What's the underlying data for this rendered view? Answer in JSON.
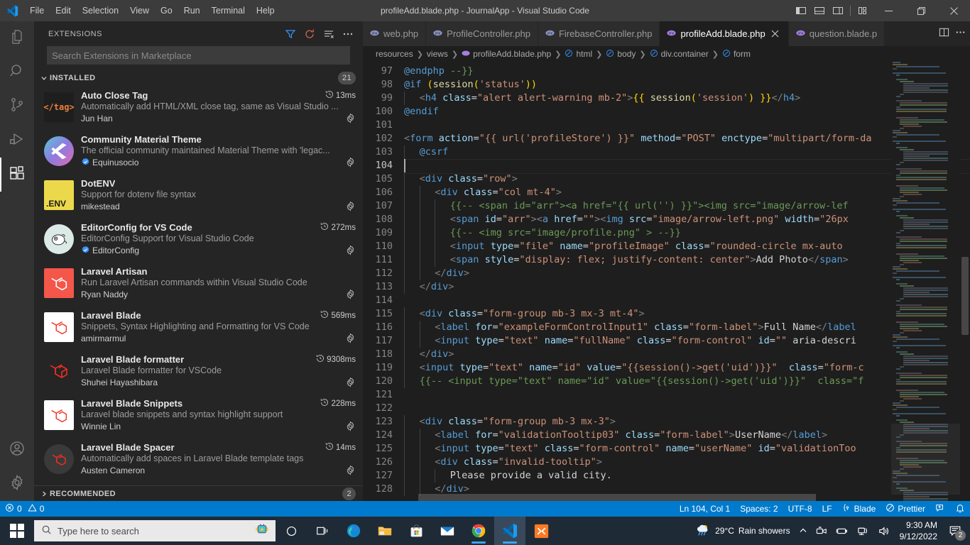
{
  "titlebar": {
    "menus": [
      "File",
      "Edit",
      "Selection",
      "View",
      "Go",
      "Run",
      "Terminal",
      "Help"
    ],
    "window_title": "profileAdd.blade.php - JournalApp - Visual Studio Code",
    "layout_buttons": [
      "toggle-primary-sidebar",
      "toggle-panel",
      "toggle-secondary-sidebar",
      "customize-layout"
    ],
    "window_controls": [
      "minimize",
      "restore",
      "close"
    ]
  },
  "activitybar": {
    "items": [
      {
        "name": "explorer",
        "icon": "files-icon",
        "active": false
      },
      {
        "name": "search",
        "icon": "search-icon",
        "active": false
      },
      {
        "name": "source-control",
        "icon": "source-control-icon",
        "active": false
      },
      {
        "name": "run-and-debug",
        "icon": "run-debug-icon",
        "active": false
      },
      {
        "name": "extensions",
        "icon": "extensions-icon",
        "active": true
      }
    ],
    "bottom": [
      {
        "name": "accounts",
        "icon": "account-icon"
      },
      {
        "name": "manage",
        "icon": "gear-icon"
      }
    ]
  },
  "sidebar": {
    "title": "EXTENSIONS",
    "actions": [
      "filter-icon",
      "refresh-icon",
      "clear-search-results-icon",
      "more-actions-icon"
    ],
    "search": {
      "value": "",
      "placeholder": "Search Extensions in Marketplace"
    },
    "installed": {
      "label": "INSTALLED",
      "count": "21",
      "expanded": true
    },
    "recommended": {
      "label": "RECOMMENDED",
      "count": "2",
      "expanded": false
    },
    "extensions": [
      {
        "name": "Auto Close Tag",
        "description": "Automatically add HTML/XML close tag, same as Visual Studio ...",
        "publisher": "Jun Han",
        "verified": false,
        "activation_time": "13ms",
        "icon_kind": "tag-text",
        "icon_text": "</tag>",
        "icon_bg": "#1e1e1e",
        "icon_fg": "#e8803a"
      },
      {
        "name": "Community Material Theme",
        "description": "The official community maintained Material Theme with 'legac...",
        "publisher": "Equinusocio",
        "verified": true,
        "activation_time": "",
        "icon_kind": "gradient-circle",
        "icon_text": "",
        "icon_bg": "#5bc8d6",
        "icon_fg": "#ffffff"
      },
      {
        "name": "DotENV",
        "description": "Support for dotenv file syntax",
        "publisher": "mikestead",
        "verified": false,
        "activation_time": "",
        "icon_kind": "env-square",
        "icon_text": ".ENV",
        "icon_bg": "#ecd94b",
        "icon_fg": "#1a1a1a"
      },
      {
        "name": "EditorConfig for VS Code",
        "description": "EditorConfig Support for Visual Studio Code",
        "publisher": "EditorConfig",
        "verified": true,
        "activation_time": "272ms",
        "icon_kind": "mouse-circle",
        "icon_text": "",
        "icon_bg": "#dbeae6",
        "icon_fg": "#2b2b2b"
      },
      {
        "name": "Laravel Artisan",
        "description": "Run Laravel Artisan commands within Visual Studio Code",
        "publisher": "Ryan Naddy",
        "verified": false,
        "activation_time": "",
        "icon_kind": "laravel-orange",
        "icon_text": "",
        "icon_bg": "#f4564a",
        "icon_fg": "#ffffff"
      },
      {
        "name": "Laravel Blade",
        "description": "Snippets, Syntax Highlighting and Formatting for VS Code",
        "publisher": "amirmarmul",
        "verified": false,
        "activation_time": "569ms",
        "icon_kind": "laravel-white",
        "icon_text": "",
        "icon_bg": "#ffffff",
        "icon_fg": "#ef3b2d"
      },
      {
        "name": "Laravel Blade formatter",
        "description": "Laravel Blade formatter for VSCode",
        "publisher": "Shuhei Hayashibara",
        "verified": false,
        "activation_time": "9308ms",
        "icon_kind": "laravel-outline",
        "icon_text": "",
        "icon_bg": "#252526",
        "icon_fg": "#ff2d20"
      },
      {
        "name": "Laravel Blade Snippets",
        "description": "Laravel blade snippets and syntax highlight support",
        "publisher": "Winnie Lin",
        "verified": false,
        "activation_time": "228ms",
        "icon_kind": "laravel-white",
        "icon_text": "",
        "icon_bg": "#ffffff",
        "icon_fg": "#ef3b2d"
      },
      {
        "name": "Laravel Blade Spacer",
        "description": "Automatically add spaces in Laravel Blade template tags",
        "publisher": "Austen Cameron",
        "verified": false,
        "activation_time": "14ms",
        "icon_kind": "laravel-dark-circle",
        "icon_text": "",
        "icon_bg": "#3a3a3a",
        "icon_fg": "#ff2d20"
      }
    ]
  },
  "editor": {
    "tabs": [
      {
        "label": "web.php",
        "active": false,
        "icon": "php-icon"
      },
      {
        "label": "ProfileController.php",
        "active": false,
        "icon": "php-icon"
      },
      {
        "label": "FirebaseController.php",
        "active": false,
        "icon": "php-icon"
      },
      {
        "label": "profileAdd.blade.php",
        "active": true,
        "icon": "php-icon"
      },
      {
        "label": "question.blade.p",
        "active": false,
        "icon": "php-icon"
      }
    ],
    "tab_actions": [
      "split-editor-icon",
      "more-actions-icon"
    ],
    "breadcrumbs": [
      {
        "label": "resources",
        "icon": ""
      },
      {
        "label": "views",
        "icon": ""
      },
      {
        "label": "profileAdd.blade.php",
        "icon": "php-icon"
      },
      {
        "label": "html",
        "icon": "symbol-field-icon"
      },
      {
        "label": "body",
        "icon": "symbol-field-icon"
      },
      {
        "label": "div.container",
        "icon": "symbol-field-icon"
      },
      {
        "label": "form",
        "icon": "symbol-field-icon"
      }
    ],
    "first_line_number": 97,
    "current_line": 104,
    "lines": [
      {
        "n": 97,
        "indent": 0,
        "text": "@endphp --}}"
      },
      {
        "n": 98,
        "indent": 0,
        "text": "@if (session('status'))"
      },
      {
        "n": 99,
        "indent": 1,
        "text": "<h4 class=\"alert alert-warning mb-2\">{{ session('session') }}</h4>"
      },
      {
        "n": 100,
        "indent": 0,
        "text": "@endif"
      },
      {
        "n": 101,
        "indent": 0,
        "text": ""
      },
      {
        "n": 102,
        "indent": 0,
        "text": "<form action=\"{{ url('profileStore') }}\" method=\"POST\" enctype=\"multipart/form-da"
      },
      {
        "n": 103,
        "indent": 1,
        "text": "@csrf"
      },
      {
        "n": 104,
        "indent": 0,
        "text": ""
      },
      {
        "n": 105,
        "indent": 1,
        "text": "<div class=\"row\">"
      },
      {
        "n": 106,
        "indent": 2,
        "text": "<div class=\"col mt-4\">"
      },
      {
        "n": 107,
        "indent": 3,
        "text": "{{-- <span id=\"arr\"><a href=\"{{ url('') }}\"><img src=\"image/arrow-lef"
      },
      {
        "n": 108,
        "indent": 3,
        "text": "<span id=\"arr\"><a href=\"\"><img src=\"image/arrow-left.png\" width=\"26px"
      },
      {
        "n": 109,
        "indent": 3,
        "text": "{{-- <img src=\"image/profile.png\" > --}}"
      },
      {
        "n": 110,
        "indent": 3,
        "text": "<input type=\"file\" name=\"profileImage\" class=\"rounded-circle mx-auto"
      },
      {
        "n": 111,
        "indent": 3,
        "text": "<span style=\"display: flex; justify-content: center\">Add Photo</span>"
      },
      {
        "n": 112,
        "indent": 2,
        "text": "</div>"
      },
      {
        "n": 113,
        "indent": 1,
        "text": "</div>"
      },
      {
        "n": 114,
        "indent": 0,
        "text": ""
      },
      {
        "n": 115,
        "indent": 1,
        "text": "<div class=\"form-group mb-3 mx-3 mt-4\">"
      },
      {
        "n": 116,
        "indent": 2,
        "text": "<label for=\"exampleFormControlInput1\" class=\"form-label\">Full Name</label"
      },
      {
        "n": 117,
        "indent": 2,
        "text": "<input type=\"text\" name=\"fullName\" class=\"form-control\" id=\"\" aria-descri"
      },
      {
        "n": 118,
        "indent": 1,
        "text": "</div>"
      },
      {
        "n": 119,
        "indent": 1,
        "text": "<input type=\"text\" name=\"id\" value=\"{{session()->get('uid')}}\"  class=\"form-c"
      },
      {
        "n": 120,
        "indent": 1,
        "text": "{{-- <input type=\"text\" name=\"id\" value=\"{{session()->get('uid')}}\"  class=\"f"
      },
      {
        "n": 121,
        "indent": 0,
        "text": ""
      },
      {
        "n": 122,
        "indent": 0,
        "text": ""
      },
      {
        "n": 123,
        "indent": 1,
        "text": "<div class=\"form-group mb-3 mx-3\">"
      },
      {
        "n": 124,
        "indent": 2,
        "text": "<label for=\"validationTooltip03\" class=\"form-label\">UserName</label>"
      },
      {
        "n": 125,
        "indent": 2,
        "text": "<input type=\"text\" class=\"form-control\" name=\"userName\" id=\"validationToo"
      },
      {
        "n": 126,
        "indent": 2,
        "text": "<div class=\"invalid-tooltip\">"
      },
      {
        "n": 127,
        "indent": 3,
        "text": "Please provide a valid city."
      },
      {
        "n": 128,
        "indent": 2,
        "text": "</div>"
      }
    ]
  },
  "statusbar": {
    "errors": "0",
    "warnings": "0",
    "position": "Ln 104, Col 1",
    "indentation": "Spaces: 2",
    "encoding": "UTF-8",
    "eol": "LF",
    "language": "Blade",
    "formatter": "Prettier",
    "feedback_icon": "feedback-icon",
    "notifications_icon": "bell-icon",
    "accent": "#007acc"
  },
  "taskbar": {
    "search_placeholder": "Type here to search",
    "apps": [
      {
        "name": "cortana",
        "running": false
      },
      {
        "name": "task-view",
        "running": false
      },
      {
        "name": "microsoft-edge",
        "running": false
      },
      {
        "name": "file-explorer",
        "running": false
      },
      {
        "name": "microsoft-store",
        "running": false
      },
      {
        "name": "mail",
        "running": false
      },
      {
        "name": "google-chrome",
        "running": true
      },
      {
        "name": "visual-studio-code",
        "running": true
      },
      {
        "name": "xampp",
        "running": false
      }
    ],
    "weather": {
      "temperature": "29°C",
      "condition": "Rain showers"
    },
    "tray_icons": [
      "show-hidden-icons",
      "meet-now-icon",
      "battery-icon",
      "network-icon",
      "volume-icon"
    ],
    "clock": {
      "time": "9:30 AM",
      "date": "9/12/2022"
    },
    "notification_count": "2"
  }
}
